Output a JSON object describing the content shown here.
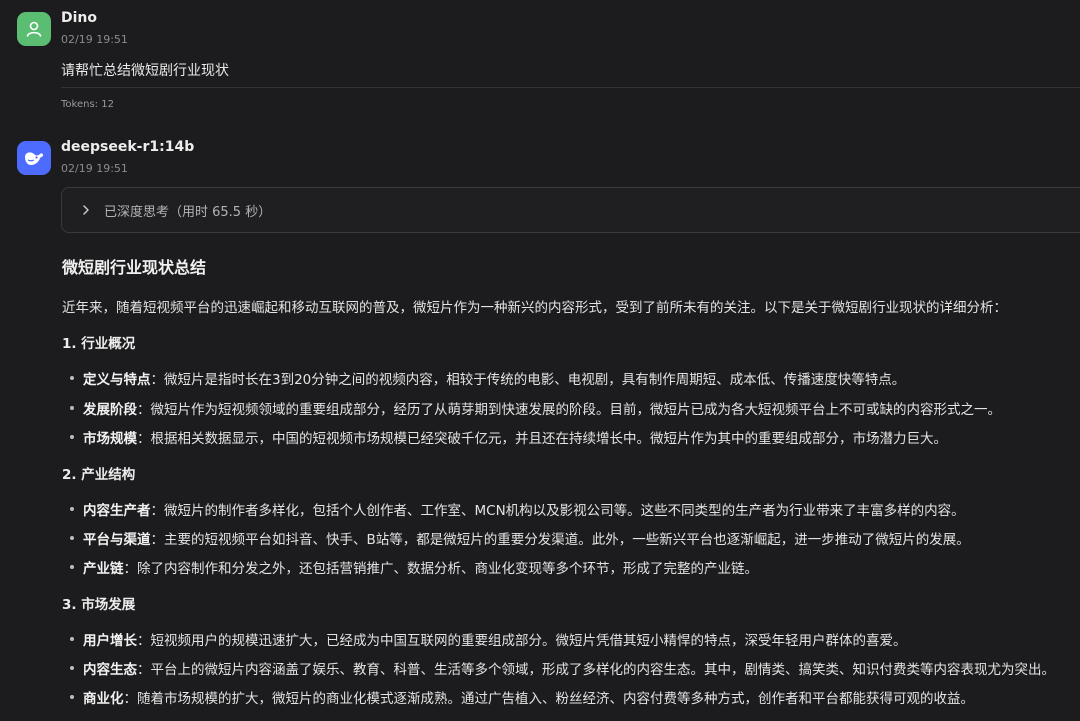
{
  "user_message": {
    "name": "Dino",
    "time": "02/19 19:51",
    "text": "请帮忙总结微短剧行业现状",
    "tokens": "Tokens: 12"
  },
  "bot_message": {
    "name": "deepseek-r1:14b",
    "time": "02/19 19:51",
    "thinking_label": "已深度思考（用时 65.5 秒）",
    "title": "微短剧行业现状总结",
    "intro": "近年来，随着短视频平台的迅速崛起和移动互联网的普及，微短片作为一种新兴的内容形式，受到了前所未有的关注。以下是关于微短剧行业现状的详细分析：",
    "sections": [
      {
        "heading": "1. 行业概况",
        "items": [
          {
            "term": "定义与特点",
            "text": "：微短片是指时长在3到20分钟之间的视频内容，相较于传统的电影、电视剧，具有制作周期短、成本低、传播速度快等特点。"
          },
          {
            "term": "发展阶段",
            "text": "：微短片作为短视频领域的重要组成部分，经历了从萌芽期到快速发展的阶段。目前，微短片已成为各大短视频平台上不可或缺的内容形式之一。"
          },
          {
            "term": "市场规模",
            "text": "：根据相关数据显示，中国的短视频市场规模已经突破千亿元，并且还在持续增长中。微短片作为其中的重要组成部分，市场潜力巨大。"
          }
        ]
      },
      {
        "heading": "2. 产业结构",
        "items": [
          {
            "term": "内容生产者",
            "text": "：微短片的制作者多样化，包括个人创作者、工作室、MCN机构以及影视公司等。这些不同类型的生产者为行业带来了丰富多样的内容。"
          },
          {
            "term": "平台与渠道",
            "text": "：主要的短视频平台如抖音、快手、B站等，都是微短片的重要分发渠道。此外，一些新兴平台也逐渐崛起，进一步推动了微短片的发展。"
          },
          {
            "term": "产业链",
            "text": "：除了内容制作和分发之外，还包括营销推广、数据分析、商业化变现等多个环节，形成了完整的产业链。"
          }
        ]
      },
      {
        "heading": "3. 市场发展",
        "items": [
          {
            "term": "用户增长",
            "text": "：短视频用户的规模迅速扩大，已经成为中国互联网的重要组成部分。微短片凭借其短小精悍的特点，深受年轻用户群体的喜爱。"
          },
          {
            "term": "内容生态",
            "text": "：平台上的微短片内容涵盖了娱乐、教育、科普、生活等多个领域，形成了多样化的内容生态。其中，剧情类、搞笑类、知识付费类等内容表现尤为突出。"
          },
          {
            "term": "商业化",
            "text": "：随着市场规模的扩大，微短片的商业化模式逐渐成熟。通过广告植入、粉丝经济、内容付费等多种方式，创作者和平台都能获得可观的收益。"
          }
        ]
      }
    ]
  },
  "icons": {
    "user_avatar": "person-icon",
    "bot_avatar": "whale-icon",
    "think_toggle": "chevron-right-icon"
  },
  "colors": {
    "background": "#1c1c1e",
    "user_avatar": "#5bbd72",
    "bot_avatar": "#4d6bfe"
  }
}
